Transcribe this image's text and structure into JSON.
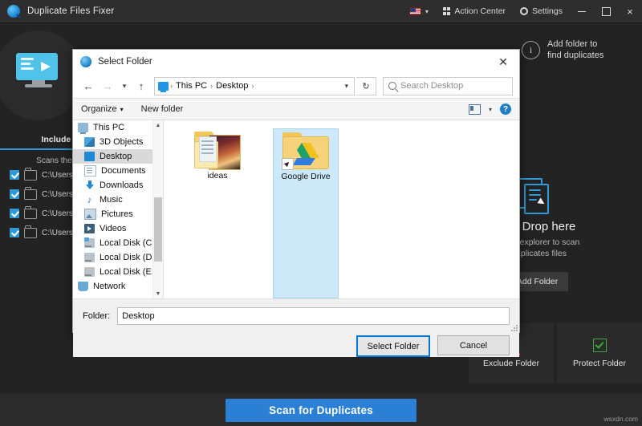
{
  "app": {
    "title": "Duplicate Files Fixer",
    "logo_icon": "magnifier-logo-icon",
    "titlebar": {
      "flag_icon": "us-flag-icon",
      "flag_chevron": "▾",
      "action_center_icon": "grid-icon",
      "action_center_label": "Action Center",
      "settings_icon": "gear-icon",
      "settings_label": "Settings",
      "minimize_label": "—",
      "maximize_label": "□",
      "close_label": "×"
    },
    "hero_icon": "monitor-cursor-icon",
    "include_panel": {
      "tab_label": "Include Files,",
      "description": "Scans the follow",
      "folders": [
        {
          "checked": true,
          "path": "C:\\Users\\"
        },
        {
          "checked": true,
          "path": "C:\\Users\\"
        },
        {
          "checked": true,
          "path": "C:\\Users\\"
        },
        {
          "checked": true,
          "path": "C:\\Users\\"
        }
      ]
    },
    "add_info": {
      "icon": "info-icon",
      "line1": "Add folder to",
      "line2": "find duplicates"
    },
    "dragdrop": {
      "icon": "documents-icon",
      "title": "rag & Drop here",
      "sub1": "der from explorer to scan",
      "sub2": "for duplicates files",
      "add_folder_label": "Add Folder",
      "add_folder_plus": "+"
    },
    "tiles": [
      {
        "name": "exclude-folder",
        "icon": "magnifier-minus-icon",
        "label": "Exclude Folder",
        "color": "#d04a43"
      },
      {
        "name": "protect-folder",
        "icon": "green-check-icon",
        "label": "Protect Folder",
        "color": "#3fa93f"
      }
    ],
    "scan_button": "Scan for Duplicates",
    "watermark": "wsxdn.com",
    "accent_color": "#2b7fd4"
  },
  "dialog": {
    "title": "Select Folder",
    "icon": "folder-dialog-icon",
    "close_label": "✕",
    "nav": {
      "back_icon": "arrow-left-icon",
      "forward_icon": "arrow-right-icon",
      "recent_icon": "chevron-down-icon",
      "up_icon": "arrow-up-icon",
      "address_icon": "this-pc-icon",
      "breadcrumbs": [
        "This PC",
        "Desktop"
      ],
      "separator": "›",
      "address_dropdown": "▾",
      "refresh_icon": "↻",
      "search_icon": "search-icon",
      "search_placeholder": "Search Desktop"
    },
    "toolbar": {
      "organize_label": "Organize",
      "organize_caret": "▾",
      "new_folder_label": "New folder",
      "view_icon": "view-layout-icon",
      "view_caret": "▾",
      "help_icon": "help-icon",
      "help_label": "?"
    },
    "tree": [
      {
        "label": "This PC",
        "icon": "pc-icon",
        "indent": "root",
        "selected": false
      },
      {
        "label": "3D Objects",
        "icon": "3d-objects-icon",
        "indent": "child",
        "selected": false
      },
      {
        "label": "Desktop",
        "icon": "desktop-icon",
        "indent": "child",
        "selected": true
      },
      {
        "label": "Documents",
        "icon": "documents-icon",
        "indent": "child",
        "selected": false
      },
      {
        "label": "Downloads",
        "icon": "downloads-icon",
        "indent": "child",
        "selected": false
      },
      {
        "label": "Music",
        "icon": "music-icon",
        "indent": "child",
        "selected": false
      },
      {
        "label": "Pictures",
        "icon": "pictures-icon",
        "indent": "child",
        "selected": false
      },
      {
        "label": "Videos",
        "icon": "videos-icon",
        "indent": "child",
        "selected": false
      },
      {
        "label": "Local Disk (C:)",
        "icon": "disk-c-icon",
        "indent": "child",
        "selected": false
      },
      {
        "label": "Local Disk (D:)",
        "icon": "disk-icon",
        "indent": "child",
        "selected": false
      },
      {
        "label": "Local Disk (E:)",
        "icon": "disk-icon",
        "indent": "child",
        "selected": false
      },
      {
        "label": "Network",
        "icon": "network-icon",
        "indent": "root",
        "selected": false
      }
    ],
    "files": [
      {
        "name": "ideas",
        "icon": "folder-with-thumbnail-icon",
        "selected": false,
        "shortcut": false
      },
      {
        "name": "Google Drive",
        "icon": "google-drive-folder-icon",
        "selected": true,
        "shortcut": true
      }
    ],
    "footer": {
      "folder_label": "Folder:",
      "folder_value": "Desktop",
      "select_label": "Select Folder",
      "cancel_label": "Cancel"
    }
  }
}
